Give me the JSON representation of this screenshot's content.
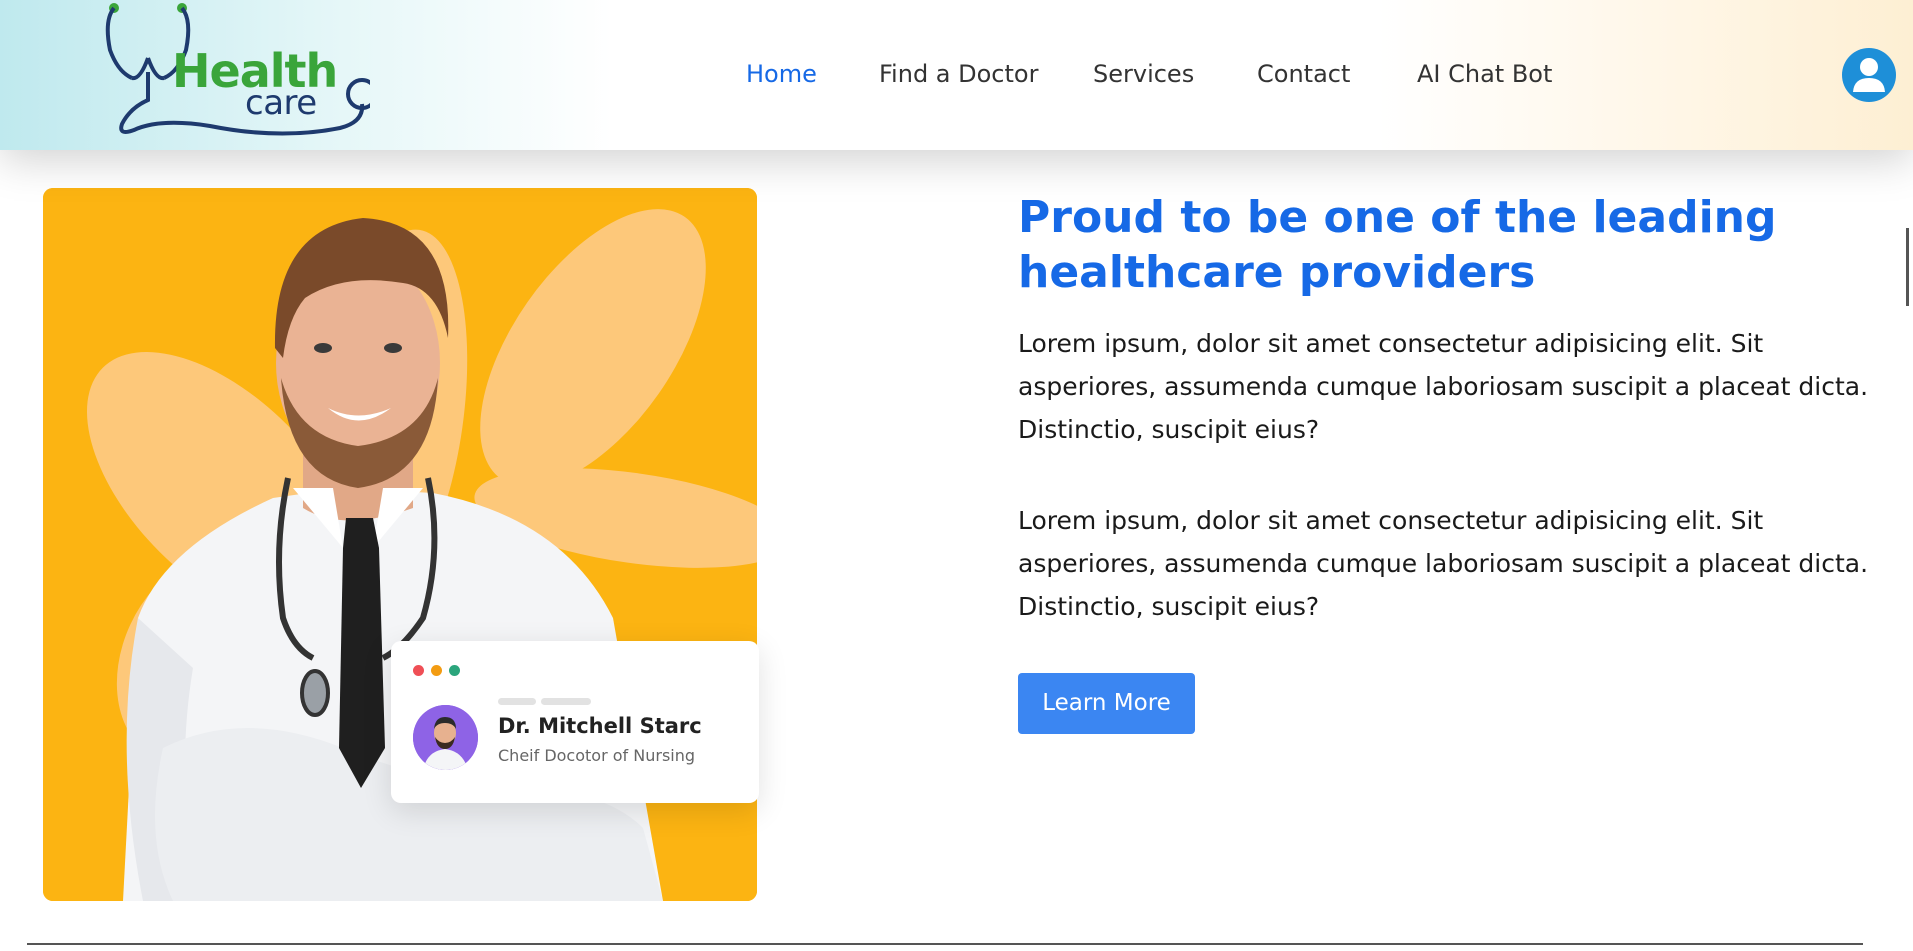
{
  "header": {
    "logo": {
      "word1": "Health",
      "word2": "care",
      "stethoscope_color": "#1e3a6e",
      "accent": "#3aa53a"
    },
    "nav": [
      {
        "label": "Home",
        "active": true
      },
      {
        "label": "Find a Doctor",
        "active": false
      },
      {
        "label": "Services",
        "active": false
      },
      {
        "label": "Contact",
        "active": false
      },
      {
        "label": "AI Chat Bot",
        "active": false
      }
    ],
    "profile_icon": "user-circle-icon"
  },
  "hero": {
    "doctor_card": {
      "name": "Dr. Mitchell Starc",
      "role": "Cheif Docotor of Nursing"
    },
    "heading": "Proud to be one of the leading healthcare providers",
    "paragraphs": [
      "Lorem ipsum, dolor sit amet consectetur adipisicing elit. Sit asperiores, assumenda cumque laboriosam suscipit a placeat dicta. Distinctio, suscipit eius?",
      "Lorem ipsum, dolor sit amet consectetur adipisicing elit. Sit asperiores, assumenda cumque laboriosam suscipit a placeat dicta. Distinctio, suscipit eius?"
    ],
    "cta_label": "Learn More"
  },
  "colors": {
    "primary": "#1669e6",
    "button": "#3b86f2",
    "photo_bg": "#fcb412"
  }
}
